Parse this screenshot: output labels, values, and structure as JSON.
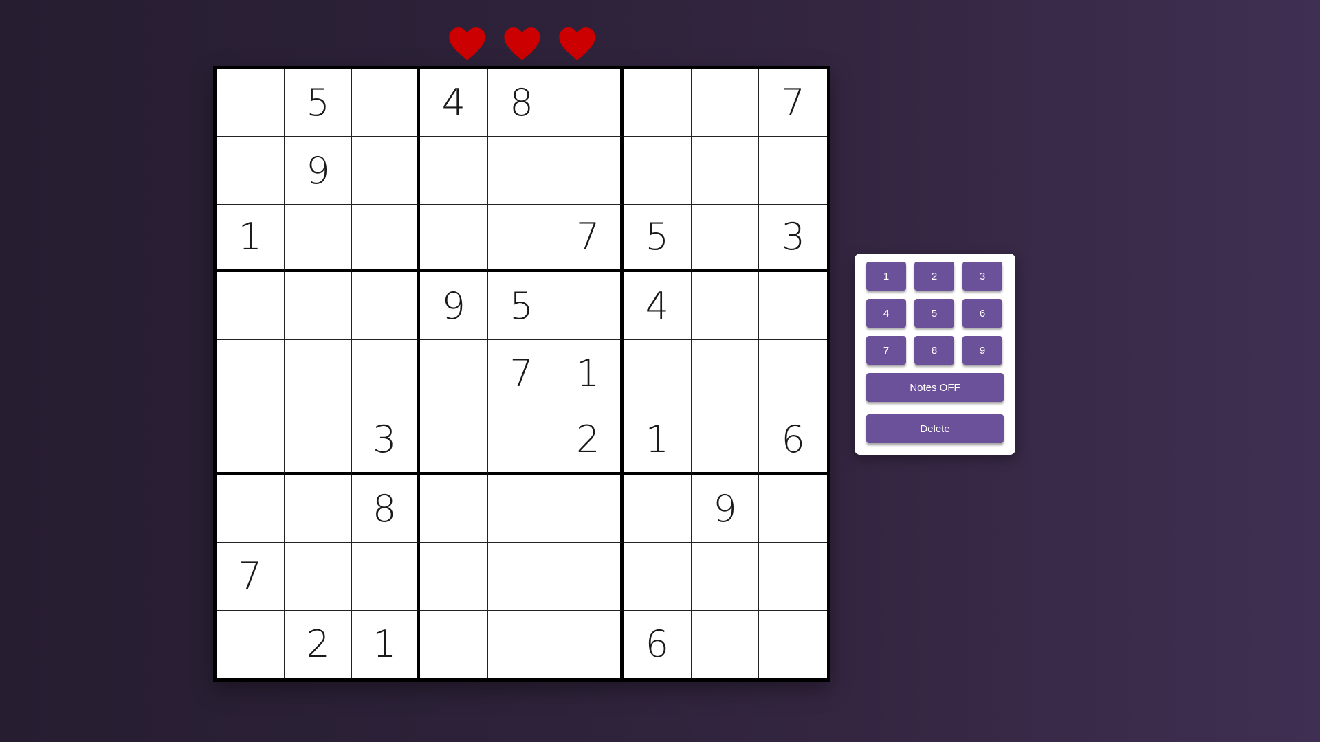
{
  "colors": {
    "heart": "#cc0000",
    "button": "#6b5199",
    "board_bg": "#ffffff",
    "grid_line": "#000000"
  },
  "lives": {
    "count": 3,
    "icon": "heart-icon"
  },
  "board": {
    "rows": [
      [
        "",
        "5",
        "",
        "4",
        "8",
        "",
        "",
        "",
        "7"
      ],
      [
        "",
        "9",
        "",
        "",
        "",
        "",
        "",
        "",
        ""
      ],
      [
        "1",
        "",
        "",
        "",
        "",
        "7",
        "5",
        "",
        "3"
      ],
      [
        "",
        "",
        "",
        "9",
        "5",
        "",
        "4",
        "",
        ""
      ],
      [
        "",
        "",
        "",
        "",
        "7",
        "1",
        "",
        "",
        ""
      ],
      [
        "",
        "",
        "3",
        "",
        "",
        "2",
        "1",
        "",
        "6"
      ],
      [
        "",
        "",
        "8",
        "",
        "",
        "",
        "",
        "9",
        ""
      ],
      [
        "7",
        "",
        "",
        "",
        "",
        "",
        "",
        "",
        ""
      ],
      [
        "",
        "2",
        "1",
        "",
        "",
        "",
        "6",
        "",
        ""
      ]
    ]
  },
  "keypad": {
    "numbers": [
      "1",
      "2",
      "3",
      "4",
      "5",
      "6",
      "7",
      "8",
      "9"
    ],
    "notes_label": "Notes OFF",
    "delete_label": "Delete"
  }
}
